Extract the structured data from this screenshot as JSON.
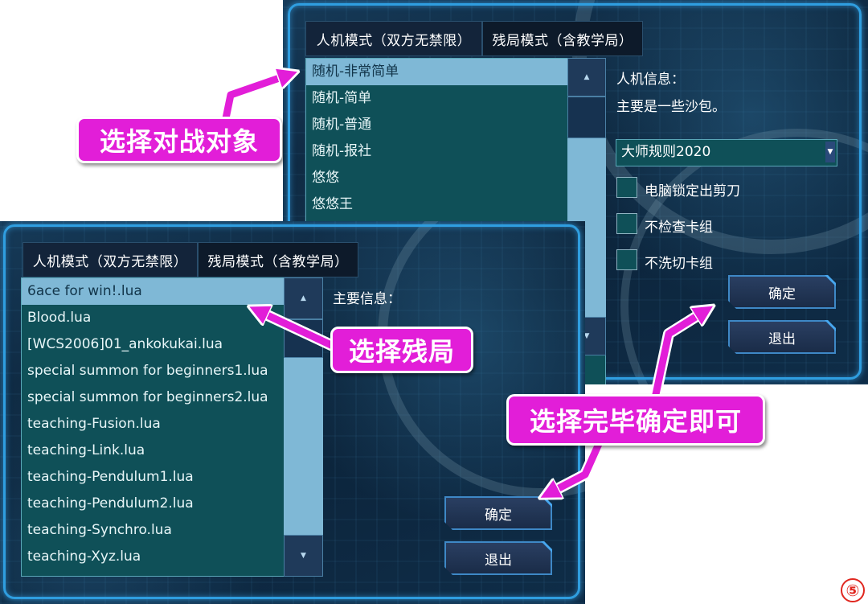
{
  "ai_window": {
    "tabs": [
      "人机模式（双方无禁限）",
      "残局模式（含教学局）"
    ],
    "opponents": [
      "随机-非常简单",
      "随机-简单",
      "随机-普通",
      "随机-报社",
      "悠悠",
      "悠悠王"
    ],
    "selected_index": 0,
    "info_title": "人机信息：",
    "info_text": "主要是一些沙包。",
    "rule_select": "大师规则2020",
    "checkboxes": [
      "电脑锁定出剪刀",
      "不检查卡组",
      "不洗切卡组"
    ],
    "confirm_label": "确定",
    "exit_label": "退出"
  },
  "puzzle_window": {
    "tabs": [
      "人机模式（双方无禁限）",
      "残局模式（含教学局）"
    ],
    "files": [
      "6ace for win!.lua",
      "Blood.lua",
      "[WCS2006]01_ankokukai.lua",
      "special summon for beginners1.lua",
      "special summon for beginners2.lua",
      "teaching-Fusion.lua",
      "teaching-Link.lua",
      "teaching-Pendulum1.lua",
      "teaching-Pendulum2.lua",
      "teaching-Synchro.lua",
      "teaching-Xyz.lua"
    ],
    "selected_index": 0,
    "info_title": "主要信息：",
    "confirm_label": "确定",
    "exit_label": "退出"
  },
  "annotations": {
    "select_opponent": "选择对战对象",
    "select_puzzle": "选择残局",
    "confirm_hint": "选择完毕确定即可",
    "step_badge": "⑤"
  },
  "colors": {
    "callout": "#e21ed8",
    "selection": "#7fb8d6",
    "list_bg": "#0f5058",
    "frame": "#2f9ee0"
  }
}
